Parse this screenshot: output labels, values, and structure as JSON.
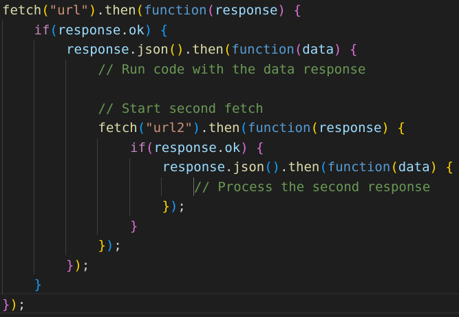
{
  "theme": {
    "background": "#1e1e1e",
    "function_color": "#dcdcaa",
    "string_color": "#ce9178",
    "keyword_color": "#c586c0",
    "storage_color": "#569cd6",
    "variable_color": "#9cdcfe",
    "comment_color": "#6a9955",
    "bracket_colors": [
      "#ffd700",
      "#da70d6",
      "#179fff"
    ]
  },
  "code": {
    "lines": [
      {
        "indent": 0,
        "tokens": [
          {
            "t": "fetch",
            "c": "fn"
          },
          {
            "t": "(",
            "c": "b1"
          },
          {
            "t": "\"url\"",
            "c": "str"
          },
          {
            "t": ")",
            "c": "b1"
          },
          {
            "t": ".",
            "c": "plain"
          },
          {
            "t": "then",
            "c": "fn"
          },
          {
            "t": "(",
            "c": "b1"
          },
          {
            "t": "function",
            "c": "fnkw"
          },
          {
            "t": "(",
            "c": "b2"
          },
          {
            "t": "response",
            "c": "var"
          },
          {
            "t": ")",
            "c": "b2"
          },
          {
            "t": " ",
            "c": "plain"
          },
          {
            "t": "{",
            "c": "b2"
          }
        ]
      },
      {
        "indent": 1,
        "tokens": [
          {
            "t": "if",
            "c": "kw"
          },
          {
            "t": "(",
            "c": "b3"
          },
          {
            "t": "response",
            "c": "var"
          },
          {
            "t": ".",
            "c": "plain"
          },
          {
            "t": "ok",
            "c": "var"
          },
          {
            "t": ")",
            "c": "b3"
          },
          {
            "t": " ",
            "c": "plain"
          },
          {
            "t": "{",
            "c": "b3"
          }
        ]
      },
      {
        "indent": 2,
        "tokens": [
          {
            "t": "response",
            "c": "var"
          },
          {
            "t": ".",
            "c": "plain"
          },
          {
            "t": "json",
            "c": "fn"
          },
          {
            "t": "()",
            "c": "b1"
          },
          {
            "t": ".",
            "c": "plain"
          },
          {
            "t": "then",
            "c": "fn"
          },
          {
            "t": "(",
            "c": "b1"
          },
          {
            "t": "function",
            "c": "fnkw"
          },
          {
            "t": "(",
            "c": "b2"
          },
          {
            "t": "data",
            "c": "var"
          },
          {
            "t": ")",
            "c": "b2"
          },
          {
            "t": " ",
            "c": "plain"
          },
          {
            "t": "{",
            "c": "b2"
          }
        ]
      },
      {
        "indent": 3,
        "tokens": [
          {
            "t": "// Run code with the data response",
            "c": "cm"
          }
        ]
      },
      {
        "indent": 0,
        "tokens": []
      },
      {
        "indent": 3,
        "tokens": [
          {
            "t": "// Start second fetch",
            "c": "cm"
          }
        ]
      },
      {
        "indent": 3,
        "tokens": [
          {
            "t": "fetch",
            "c": "fn"
          },
          {
            "t": "(",
            "c": "b3"
          },
          {
            "t": "\"url2\"",
            "c": "str"
          },
          {
            "t": ")",
            "c": "b3"
          },
          {
            "t": ".",
            "c": "plain"
          },
          {
            "t": "then",
            "c": "fn"
          },
          {
            "t": "(",
            "c": "b3"
          },
          {
            "t": "function",
            "c": "fnkw"
          },
          {
            "t": "(",
            "c": "b1"
          },
          {
            "t": "response",
            "c": "var"
          },
          {
            "t": ")",
            "c": "b1"
          },
          {
            "t": " ",
            "c": "plain"
          },
          {
            "t": "{",
            "c": "b1"
          }
        ]
      },
      {
        "indent": 4,
        "tokens": [
          {
            "t": "if",
            "c": "kw"
          },
          {
            "t": "(",
            "c": "b2"
          },
          {
            "t": "response",
            "c": "var"
          },
          {
            "t": ".",
            "c": "plain"
          },
          {
            "t": "ok",
            "c": "var"
          },
          {
            "t": ")",
            "c": "b2"
          },
          {
            "t": " ",
            "c": "plain"
          },
          {
            "t": "{",
            "c": "b2"
          }
        ]
      },
      {
        "indent": 5,
        "tokens": [
          {
            "t": "response",
            "c": "var"
          },
          {
            "t": ".",
            "c": "plain"
          },
          {
            "t": "json",
            "c": "fn"
          },
          {
            "t": "()",
            "c": "b3"
          },
          {
            "t": ".",
            "c": "plain"
          },
          {
            "t": "then",
            "c": "fn"
          },
          {
            "t": "(",
            "c": "b3"
          },
          {
            "t": "function",
            "c": "fnkw"
          },
          {
            "t": "(",
            "c": "b1"
          },
          {
            "t": "data",
            "c": "var"
          },
          {
            "t": ")",
            "c": "b1"
          },
          {
            "t": " ",
            "c": "plain"
          },
          {
            "t": "{",
            "c": "b1"
          }
        ]
      },
      {
        "indent": 6,
        "tokens": [
          {
            "t": "// Process the second response",
            "c": "cm"
          }
        ]
      },
      {
        "indent": 5,
        "tokens": [
          {
            "t": "}",
            "c": "b1"
          },
          {
            "t": ")",
            "c": "b3"
          },
          {
            "t": ";",
            "c": "plain"
          }
        ]
      },
      {
        "indent": 4,
        "tokens": [
          {
            "t": "}",
            "c": "b2"
          }
        ]
      },
      {
        "indent": 3,
        "tokens": [
          {
            "t": "}",
            "c": "b1"
          },
          {
            "t": ")",
            "c": "b3"
          },
          {
            "t": ";",
            "c": "plain"
          }
        ]
      },
      {
        "indent": 2,
        "tokens": [
          {
            "t": "}",
            "c": "b2"
          },
          {
            "t": ")",
            "c": "b1"
          },
          {
            "t": ";",
            "c": "plain"
          }
        ]
      },
      {
        "indent": 1,
        "tokens": [
          {
            "t": "}",
            "c": "b3"
          }
        ]
      },
      {
        "indent": 0,
        "tokens": [
          {
            "t": "}",
            "c": "b2"
          },
          {
            "t": ")",
            "c": "b1"
          },
          {
            "t": ";",
            "c": "plain"
          }
        ]
      }
    ]
  }
}
